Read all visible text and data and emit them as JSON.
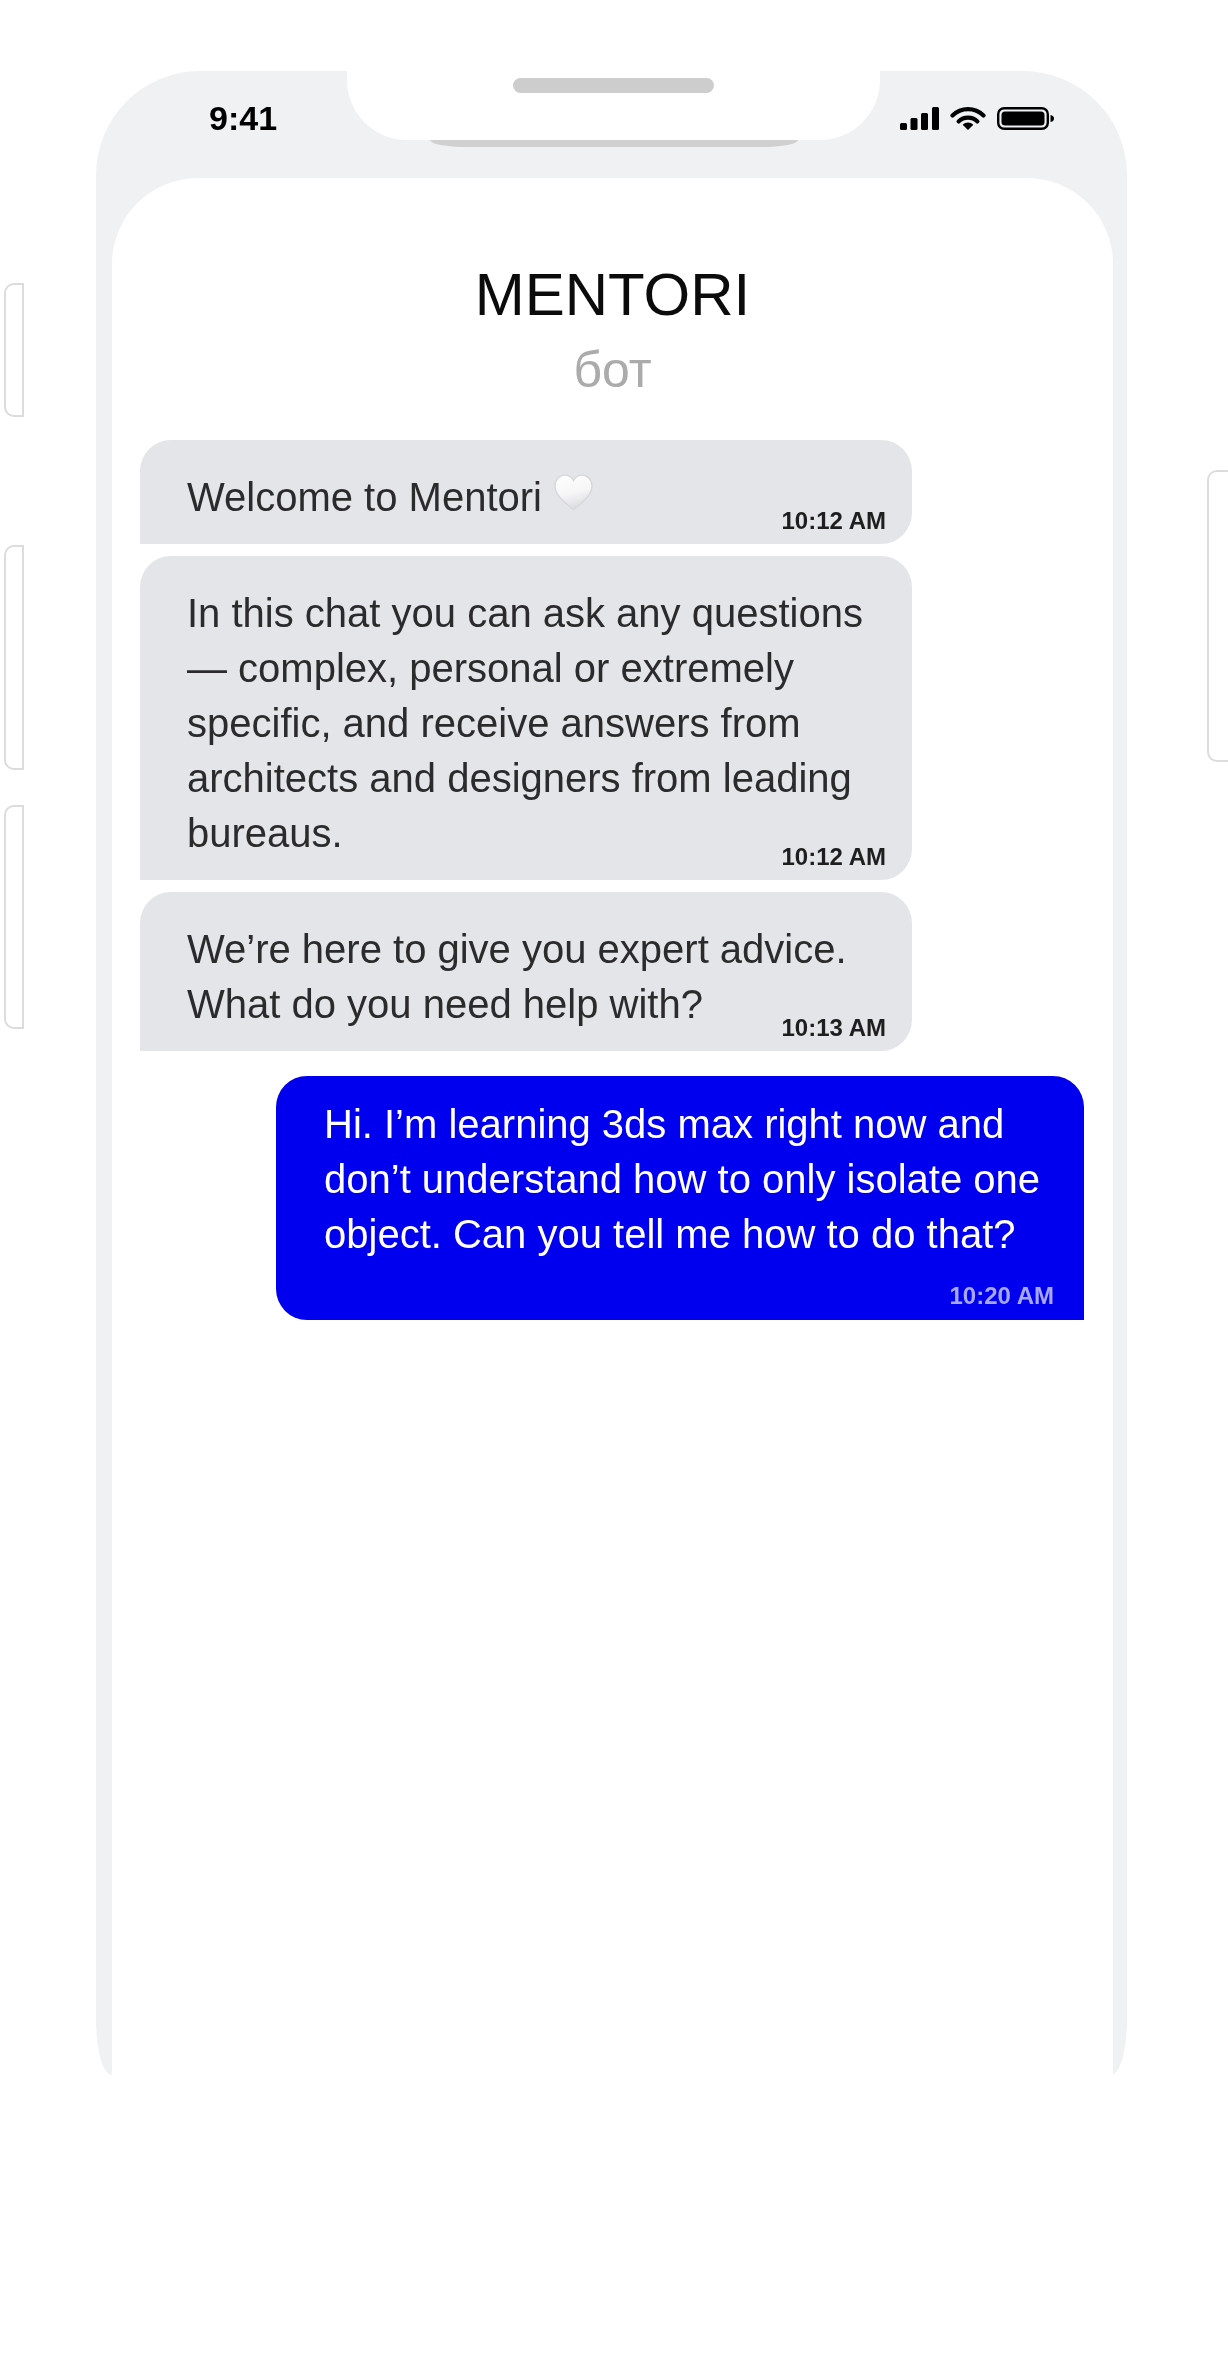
{
  "status_bar": {
    "time": "9:41"
  },
  "header": {
    "title": "MENTORI",
    "subtitle": "бот"
  },
  "messages": [
    {
      "kind": "incoming",
      "text": "Welcome to Mentori",
      "end_icon": true,
      "time": "10:12 AM"
    },
    {
      "kind": "incoming",
      "text": "In this chat you can ask any questions — complex, personal or extremely specific, and receive answers from architects and designers from leading bureaus.",
      "end_icon": false,
      "time": "10:12 AM"
    },
    {
      "kind": "incoming",
      "text": "We’re here to give you expert advice. What do you need help with?",
      "end_icon": false,
      "time": "10:13 AM"
    },
    {
      "kind": "outgoing",
      "text": "Hi. I’m learning 3ds max right now and don’t understand how to only isolate one object. Can you tell me how to do that?",
      "end_icon": false,
      "time": "10:20 AM"
    }
  ]
}
